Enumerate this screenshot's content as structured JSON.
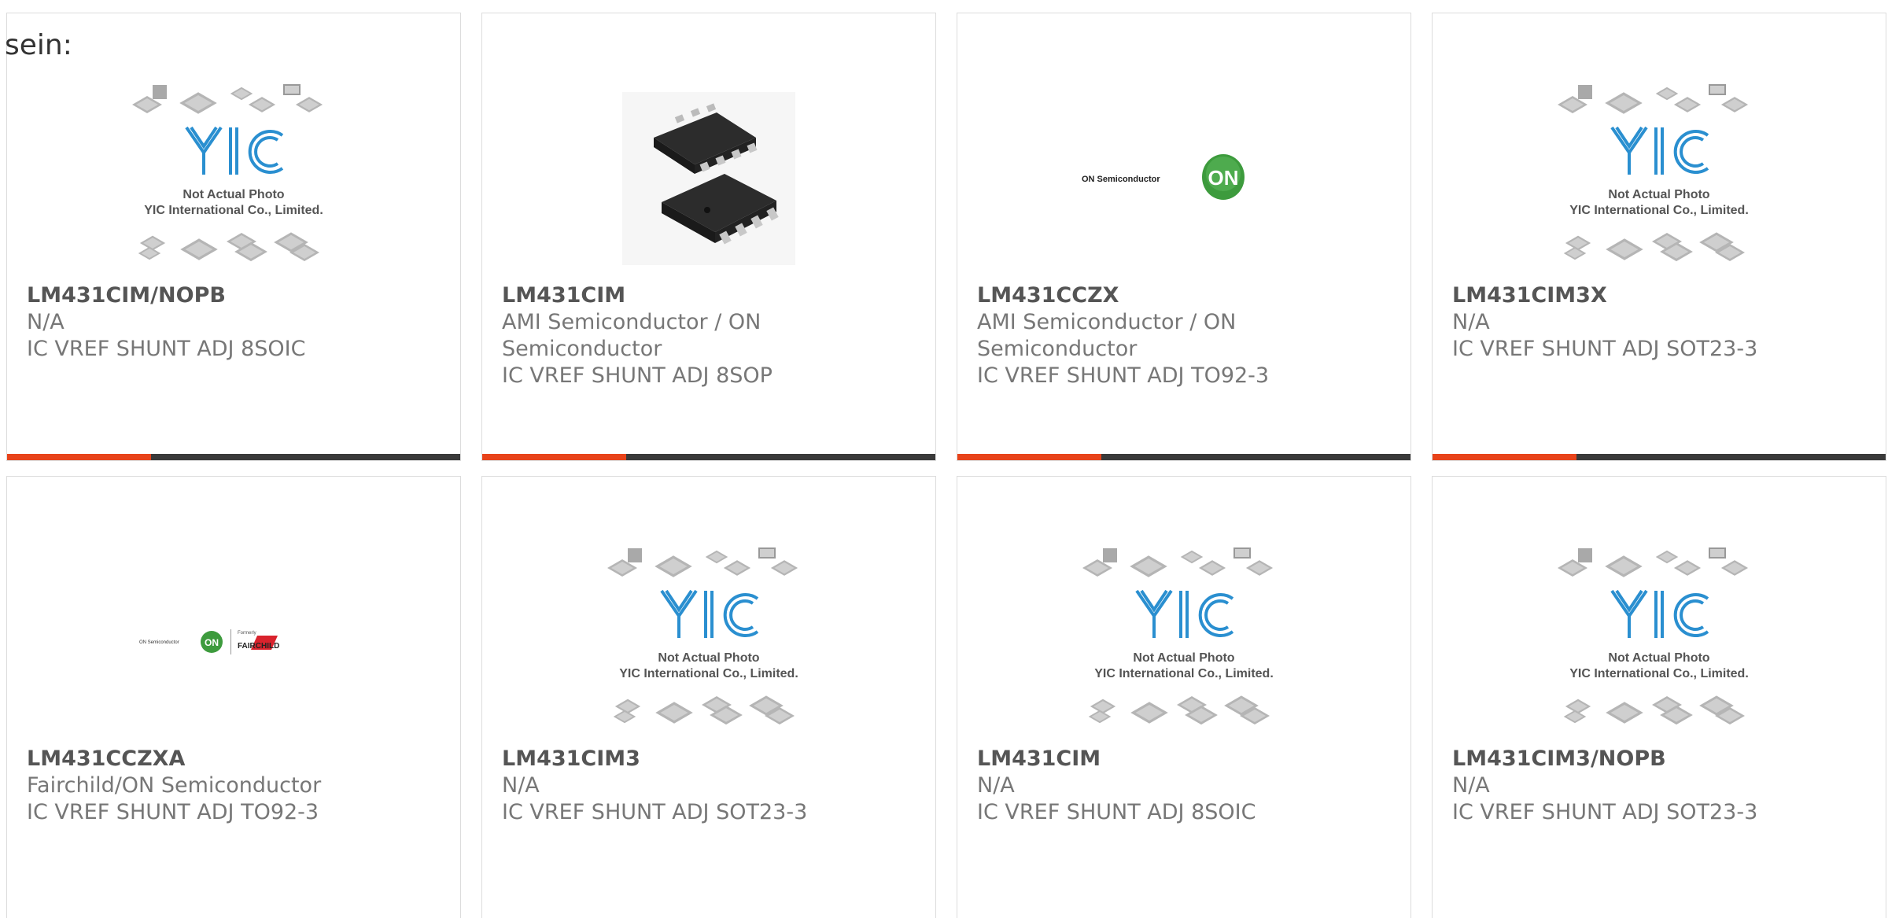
{
  "lead_text": "sein:",
  "colors": {
    "accent": "#e8431a",
    "bar": "#3a3a3a",
    "logo_blue": "#2a8fd0",
    "on_green": "#3d9b3d"
  },
  "placeholder": {
    "line1": "Not Actual Photo",
    "line2": "YIC International Co., Limited.",
    "logo_text": "YIC"
  },
  "on_logo": {
    "wordmark": "ON Semiconductor",
    "badge": "ON"
  },
  "fairchild_logo": {
    "wordmark": "ON Semiconductor",
    "badge": "ON",
    "formerly": "Formerly",
    "brand": "FAIRCHILD"
  },
  "products": [
    {
      "part": "LM431CIM/NOPB",
      "manufacturer": "N/A",
      "description": "IC VREF SHUNT ADJ 8SOIC",
      "image": "yic-placeholder-icon"
    },
    {
      "part": "LM431CIM",
      "manufacturer": "AMI Semiconductor / ON Semiconductor",
      "description": "IC VREF SHUNT ADJ 8SOP",
      "image": "soic-chip-photo"
    },
    {
      "part": "LM431CCZX",
      "manufacturer": "AMI Semiconductor / ON Semiconductor",
      "description": "IC VREF SHUNT ADJ TO92-3",
      "image": "on-semiconductor-logo"
    },
    {
      "part": "LM431CIM3X",
      "manufacturer": "N/A",
      "description": "IC VREF SHUNT ADJ SOT23-3",
      "image": "yic-placeholder-icon"
    },
    {
      "part": "LM431CCZXA",
      "manufacturer": "Fairchild/ON Semiconductor",
      "description": "IC VREF SHUNT ADJ TO92-3",
      "image": "fairchild-on-logo"
    },
    {
      "part": "LM431CIM3",
      "manufacturer": "N/A",
      "description": "IC VREF SHUNT ADJ SOT23-3",
      "image": "yic-placeholder-icon"
    },
    {
      "part": "LM431CIM",
      "manufacturer": "N/A",
      "description": "IC VREF SHUNT ADJ 8SOIC",
      "image": "yic-placeholder-icon"
    },
    {
      "part": "LM431CIM3/NOPB",
      "manufacturer": "N/A",
      "description": "IC VREF SHUNT ADJ SOT23-3",
      "image": "yic-placeholder-icon"
    }
  ]
}
